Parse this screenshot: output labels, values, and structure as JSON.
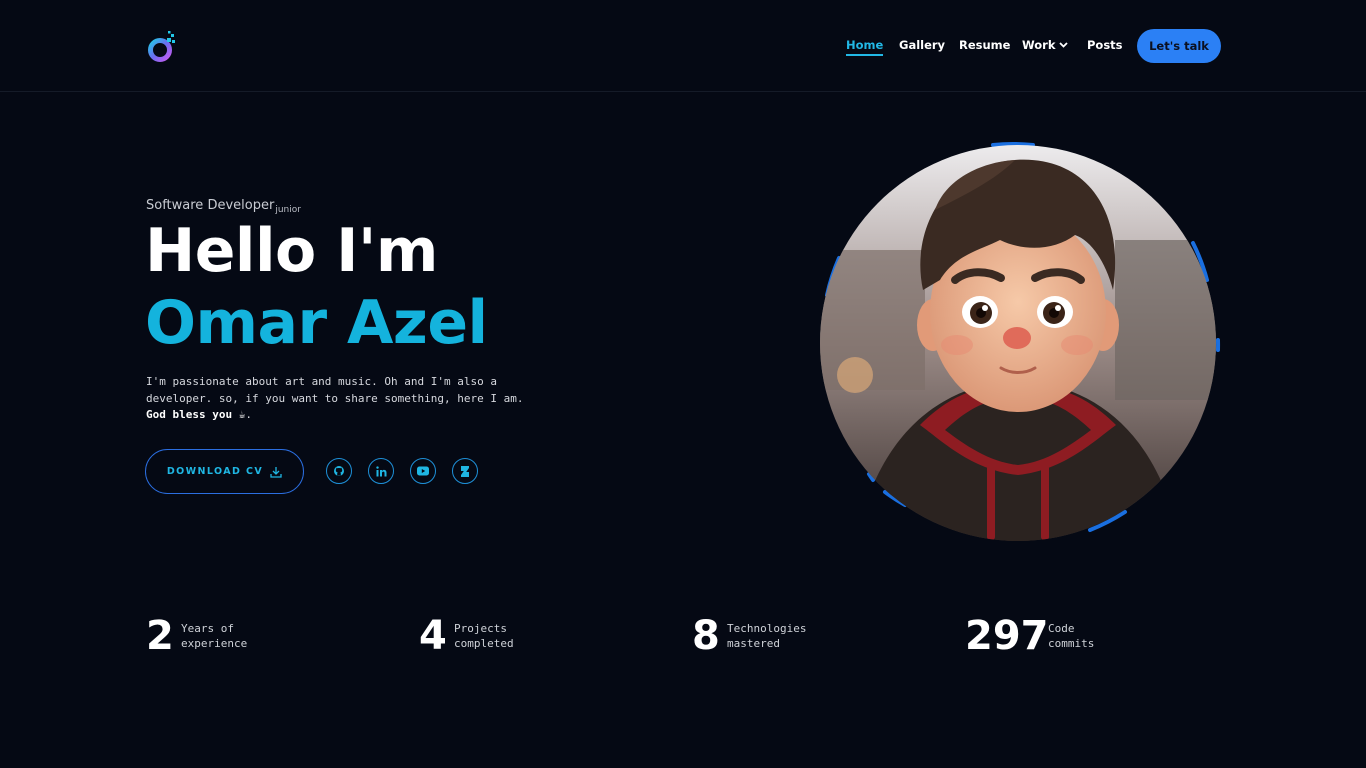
{
  "brand": {
    "logo_icon": "orbit-logo-icon",
    "colors": {
      "accent": "#14b3dd",
      "button": "#2b80f5",
      "background": "#050914"
    }
  },
  "nav": {
    "items": [
      {
        "label": "Home",
        "active": true
      },
      {
        "label": "Gallery",
        "active": false
      },
      {
        "label": "Resume",
        "active": false
      },
      {
        "label": "Work",
        "active": false,
        "icon": "chevron-down-icon"
      },
      {
        "label": "Posts",
        "active": false
      }
    ],
    "cta_label": "Let's talk"
  },
  "hero": {
    "role": "Software Developer",
    "role_level": "junior",
    "greeting": "Hello I'm",
    "name": "Omar Azel",
    "description": {
      "line1": "I'm passionate about art and music. Oh and I'm also a",
      "line2": "developer. so, if you want to share something, here I am.",
      "line3_bold": "God bless you ☕",
      "line3_end": "."
    },
    "download_label": "DOWNLOAD CV",
    "download_icon": "download-icon",
    "socials": [
      "github-icon",
      "linkedin-icon",
      "youtube-icon",
      "deviantart-icon"
    ]
  },
  "portrait": {
    "subject": "avatar-portrait"
  },
  "stats": [
    {
      "value": "2",
      "label_line1": "Years of",
      "label_line2": "experience"
    },
    {
      "value": "4",
      "label_line1": "Projects",
      "label_line2": "completed"
    },
    {
      "value": "8",
      "label_line1": "Technologies",
      "label_line2": "mastered"
    },
    {
      "value": "297",
      "label_line1": "Code",
      "label_line2": "commits"
    }
  ]
}
